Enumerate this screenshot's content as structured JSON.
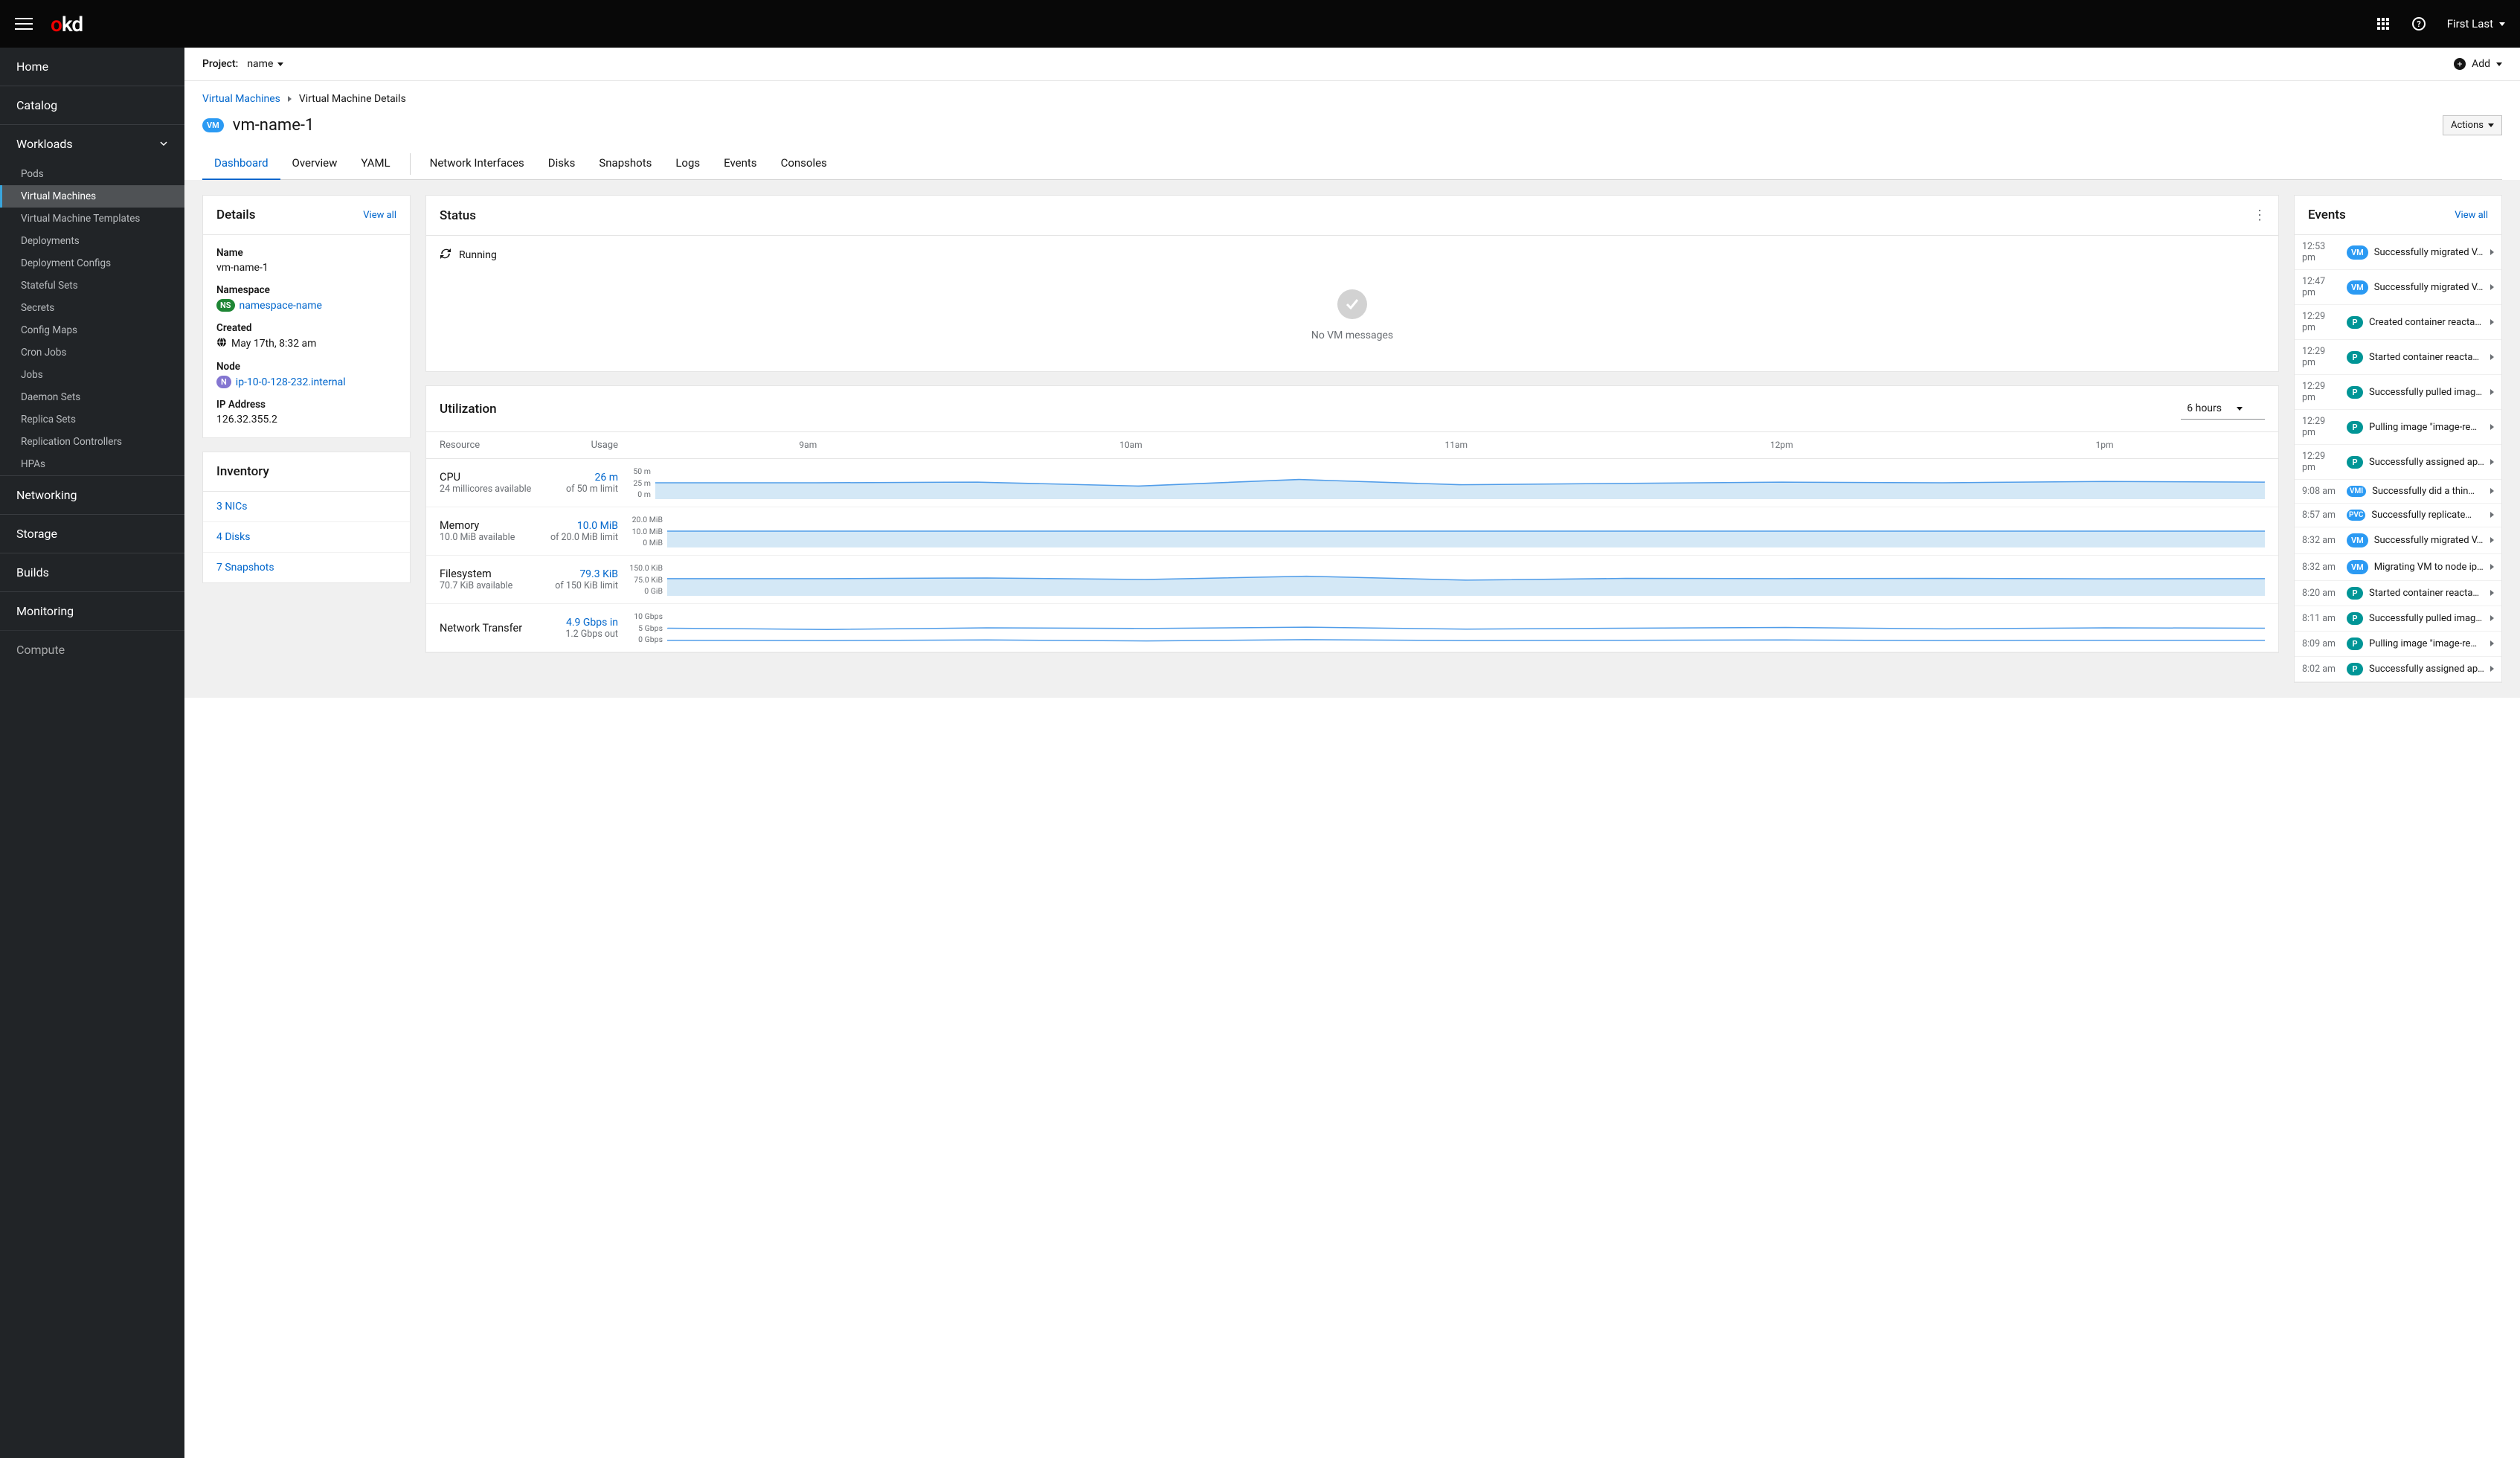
{
  "topbar": {
    "logo_o": "o",
    "logo_kd": "kd",
    "user": "First Last"
  },
  "sidebar": {
    "home": "Home",
    "catalog": "Catalog",
    "workloads": "Workloads",
    "workloads_items": [
      "Pods",
      "Virtual Machines",
      "Virtual Machine Templates",
      "Deployments",
      "Deployment Configs",
      "Stateful Sets",
      "Secrets",
      "Config Maps",
      "Cron Jobs",
      "Jobs",
      "Daemon Sets",
      "Replica Sets",
      "Replication Controllers",
      "HPAs"
    ],
    "networking": "Networking",
    "storage": "Storage",
    "builds": "Builds",
    "monitoring": "Monitoring",
    "compute": "Compute"
  },
  "projectbar": {
    "label": "Project:",
    "value": "name",
    "add": "Add"
  },
  "breadcrumb": {
    "root": "Virtual Machines",
    "current": "Virtual Machine Details"
  },
  "page_title": "vm-name-1",
  "vm_badge": "VM",
  "actions_label": "Actions",
  "tabs": [
    "Dashboard",
    "Overview",
    "YAML",
    "Network Interfaces",
    "Disks",
    "Snapshots",
    "Logs",
    "Events",
    "Consoles"
  ],
  "details": {
    "title": "Details",
    "view_all": "View all",
    "name_label": "Name",
    "name_value": "vm-name-1",
    "namespace_label": "Namespace",
    "namespace_badge": "NS",
    "namespace_value": "namespace-name",
    "created_label": "Created",
    "created_value": "May 17th, 8:32 am",
    "node_label": "Node",
    "node_badge": "N",
    "node_value": "ip-10-0-128-232.internal",
    "ip_label": "IP Address",
    "ip_value": "126.32.355.2"
  },
  "inventory": {
    "title": "Inventory",
    "items": [
      "3 NICs",
      "4 Disks",
      "7 Snapshots"
    ]
  },
  "status": {
    "title": "Status",
    "running": "Running",
    "empty": "No VM messages"
  },
  "utilization": {
    "title": "Utilization",
    "range": "6 hours",
    "head_resource": "Resource",
    "head_usage": "Usage",
    "time_labels": [
      "9am",
      "10am",
      "11am",
      "12pm",
      "1pm"
    ],
    "rows": [
      {
        "name": "CPU",
        "sub": "24 millicores available",
        "val": "26 m",
        "lim": "of 50 m limit",
        "y": [
          "50 m",
          "25 m",
          "0 m"
        ]
      },
      {
        "name": "Memory",
        "sub": "10.0 MiB available",
        "val": "10.0 MiB",
        "lim": "of 20.0 MiB limit",
        "y": [
          "20.0 MiB",
          "10.0 MiB",
          "0 MiB"
        ]
      },
      {
        "name": "Filesystem",
        "sub": "70.7 KiB available",
        "val": "79.3 KiB",
        "lim": "of 150 KiB limit",
        "y": [
          "150.0 KiB",
          "75.0 KiB",
          "0 GiB"
        ]
      },
      {
        "name": "Network Transfer",
        "sub": "",
        "val": "4.9 Gbps in",
        "lim": "1.2 Gbps out",
        "y": [
          "10 Gbps",
          "5 Gbps",
          "0 Gbps"
        ]
      }
    ]
  },
  "events": {
    "title": "Events",
    "view_all": "View all",
    "list": [
      {
        "time": "12:53 pm",
        "type": "VM",
        "msg": "Successfully migrated V…"
      },
      {
        "time": "12:47 pm",
        "type": "VM",
        "msg": "Successfully migrated V…"
      },
      {
        "time": "12:29 pm",
        "type": "P",
        "msg": "Created container reacta…"
      },
      {
        "time": "12:29 pm",
        "type": "P",
        "msg": "Started container reacta…"
      },
      {
        "time": "12:29 pm",
        "type": "P",
        "msg": "Successfully pulled imag…"
      },
      {
        "time": "12:29 pm",
        "type": "P",
        "msg": "Pulling image \"image-re…"
      },
      {
        "time": "12:29 pm",
        "type": "P",
        "msg": "Successfully assigned ap…"
      },
      {
        "time": "9:08 am",
        "type": "VMI",
        "msg": "Successfully did a thin…"
      },
      {
        "time": "8:57 am",
        "type": "PVC",
        "msg": "Successfully replicate…"
      },
      {
        "time": "8:32 am",
        "type": "VM",
        "msg": "Successfully migrated V…"
      },
      {
        "time": "8:32 am",
        "type": "VM",
        "msg": "Migrating VM to node ip…"
      },
      {
        "time": "8:20 am",
        "type": "P",
        "msg": "Started container reacta…"
      },
      {
        "time": "8:11 am",
        "type": "P",
        "msg": "Successfully pulled imag…"
      },
      {
        "time": "8:09 am",
        "type": "P",
        "msg": "Pulling image \"image-re…"
      },
      {
        "time": "8:02 am",
        "type": "P",
        "msg": "Successfully assigned ap…"
      }
    ]
  },
  "chart_data": [
    {
      "type": "area",
      "name": "CPU",
      "ylim": [
        0,
        50
      ],
      "unit": "m",
      "x": [
        "9am",
        "10am",
        "11am",
        "12pm",
        "1pm"
      ],
      "values": [
        25,
        25,
        26,
        20,
        30,
        22,
        24,
        26,
        25,
        27,
        26
      ]
    },
    {
      "type": "area",
      "name": "Memory",
      "ylim": [
        0,
        20
      ],
      "unit": "MiB",
      "x": [
        "9am",
        "10am",
        "11am",
        "12pm",
        "1pm"
      ],
      "values": [
        10,
        10,
        10,
        10,
        10,
        10,
        10,
        10,
        10,
        10,
        10
      ]
    },
    {
      "type": "area",
      "name": "Filesystem",
      "ylim": [
        0,
        150
      ],
      "unit": "KiB",
      "x": [
        "9am",
        "10am",
        "11am",
        "12pm",
        "1pm"
      ],
      "values": [
        79,
        79,
        82,
        75,
        90,
        72,
        80,
        79,
        80,
        78,
        79
      ]
    },
    {
      "type": "line",
      "name": "Network Transfer",
      "ylim": [
        0,
        10
      ],
      "unit": "Gbps",
      "x": [
        "9am",
        "10am",
        "11am",
        "12pm",
        "1pm"
      ],
      "series": [
        {
          "name": "in",
          "values": [
            4.9,
            4.5,
            5.0,
            4.8,
            5.2,
            4.6,
            4.9,
            5.1,
            4.7,
            5.0,
            4.9
          ]
        },
        {
          "name": "out",
          "values": [
            1.2,
            1.1,
            1.3,
            1.0,
            1.4,
            1.1,
            1.2,
            1.3,
            1.1,
            1.2,
            1.2
          ]
        }
      ]
    }
  ]
}
